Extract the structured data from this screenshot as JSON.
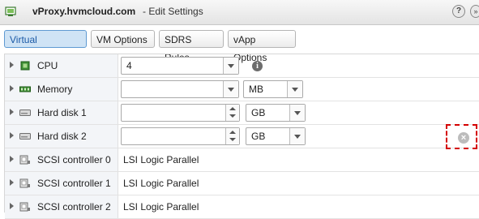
{
  "window": {
    "vm_name": "vProxy.hvmcloud.com",
    "subtitle": "- Edit Settings",
    "help_icon": "help-icon",
    "help_glyph": "?",
    "expand_icon": "expand-icon",
    "expand_glyph": "»"
  },
  "tabs": [
    {
      "label": "Virtual Hardware",
      "active": true
    },
    {
      "label": "VM Options",
      "active": false
    },
    {
      "label": "SDRS Rules",
      "active": false
    },
    {
      "label": "vApp Options",
      "active": false
    }
  ],
  "devices": [
    {
      "label": "CPU",
      "icon": "cpu-icon",
      "value": "4",
      "control": "combo"
    },
    {
      "label": "Memory",
      "icon": "memory-icon",
      "value": "",
      "unit": "MB",
      "control": "combo+unit"
    },
    {
      "label": "Hard disk 1",
      "icon": "hard-disk-icon",
      "value": "",
      "unit": "GB",
      "control": "spinner+unit"
    },
    {
      "label": "Hard disk 2",
      "icon": "hard-disk-icon",
      "value": "",
      "unit": "GB",
      "control": "spinner+unit"
    },
    {
      "label": "SCSI controller 0",
      "icon": "scsi-controller-icon",
      "value": "LSI Logic Parallel",
      "control": "static"
    },
    {
      "label": "SCSI controller 1",
      "icon": "scsi-controller-icon",
      "value": "LSI Logic Parallel",
      "control": "static"
    },
    {
      "label": "SCSI controller 2",
      "icon": "scsi-controller-icon",
      "value": "LSI Logic Parallel",
      "control": "static"
    }
  ],
  "info_icon": "info-icon",
  "info_glyph": "i",
  "remove_icon": "remove-device-icon",
  "remove_glyph": "×",
  "colors": {
    "active_tab_bg": "#cfe3f5",
    "active_tab_text": "#1b5aa6",
    "highlight_dash": "#d40000"
  }
}
